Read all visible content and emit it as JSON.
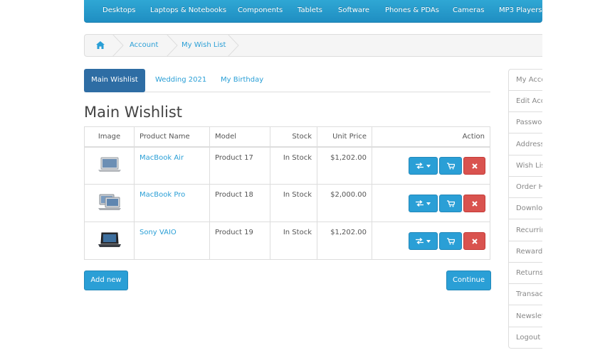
{
  "topnav": {
    "items": [
      "Desktops",
      "Laptops & Notebooks",
      "Components",
      "Tablets",
      "Software",
      "Phones & PDAs",
      "Cameras",
      "MP3 Players"
    ]
  },
  "breadcrumb": {
    "home_icon": "home-icon",
    "items": [
      "Account",
      "My Wish List"
    ]
  },
  "tabs": [
    {
      "label": "Main Wishlist",
      "active": true
    },
    {
      "label": "Wedding 2021",
      "active": false
    },
    {
      "label": "My Birthday",
      "active": false
    }
  ],
  "page_title": "Main Wishlist",
  "table": {
    "headers": [
      "Image",
      "Product Name",
      "Model",
      "Stock",
      "Unit Price",
      "Action"
    ],
    "rows": [
      {
        "name": "MacBook Air",
        "model": "Product 17",
        "stock": "In Stock",
        "price": "$1,202.00"
      },
      {
        "name": "MacBook Pro",
        "model": "Product 18",
        "stock": "In Stock",
        "price": "$2,000.00"
      },
      {
        "name": "Sony VAIO",
        "model": "Product 19",
        "stock": "In Stock",
        "price": "$1,202.00"
      }
    ]
  },
  "buttons": {
    "add_new": "Add new",
    "continue": "Continue"
  },
  "sidebar": {
    "items": [
      "My Acco",
      "Edit Acco",
      "Passwor",
      "Address",
      "Wish Lis",
      "Order H",
      "Downloa",
      "Recurrin",
      "Reward",
      "Returns",
      "Transact",
      "Newslet",
      "Logout"
    ]
  },
  "colors": {
    "accent": "#2a9fd6",
    "active_tab": "#2e6da4",
    "danger": "#d9534f"
  }
}
